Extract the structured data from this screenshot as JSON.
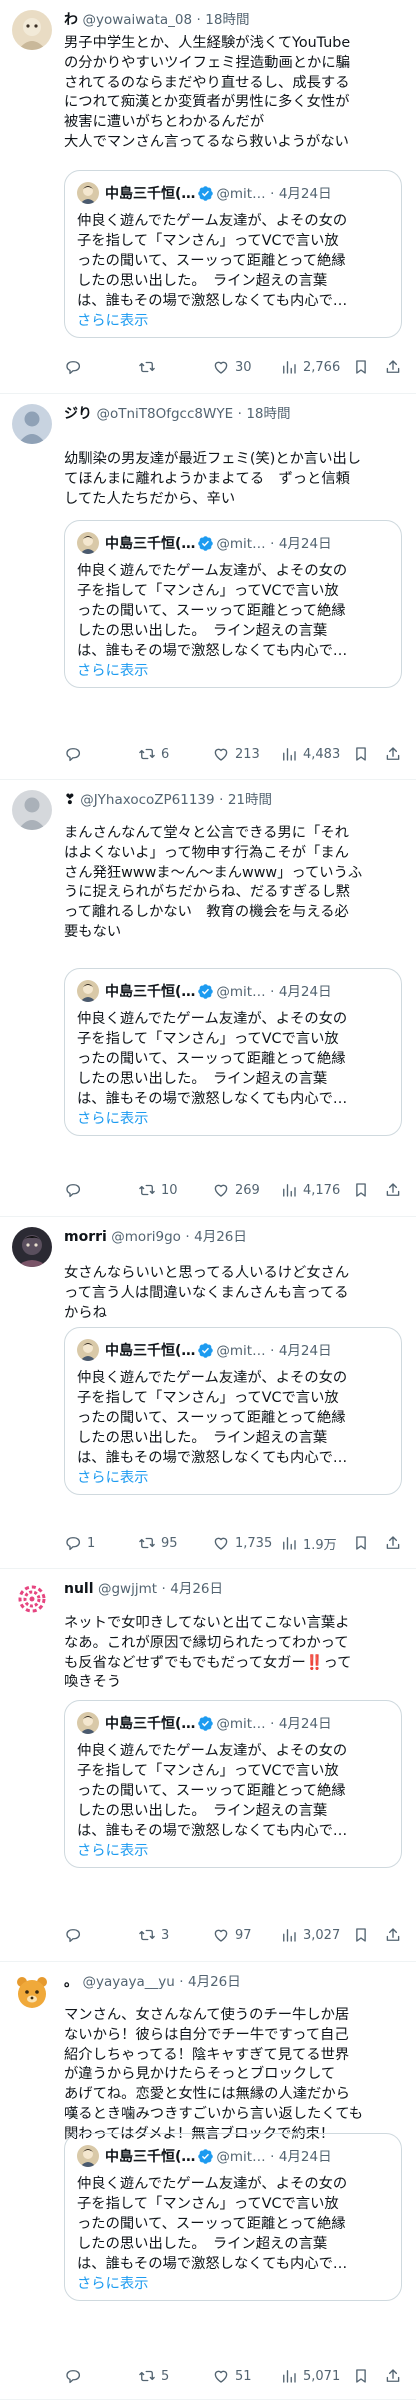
{
  "quoted": {
    "name": "中島三千恒(…",
    "handle": "@mit…",
    "dot": "·",
    "time": "4月24日",
    "lines": [
      "仲良く遊んでたゲーム友達が、よその女の",
      "子を指して「マンさん」ってVCで言い放",
      "ったの聞いて、スーッって距離とって絶縁",
      "したの思い出した。　ライン超えの言葉",
      "は、誰もその場で激怒しなくても内心で…"
    ],
    "more": "さらに表示"
  },
  "tweets": [
    {
      "name": "わ",
      "handle": "@yowaiwata_08",
      "dot": "·",
      "time": "18時間",
      "lines": [
        "男子中学生とか、人生経験が浅くてYouTube",
        "の分かりやすいツイフェミ捏造動画とかに騙",
        "されてるのならまだやり直せるし、成長する",
        "につれて痴漢とか変質者が男性に多く女性が",
        "被害に遭いがちとわかるんだが",
        "大人でマンさん言ってるなら救いようがない"
      ],
      "replies": "",
      "retweets": "",
      "likes": "30",
      "views": "2,766"
    },
    {
      "name": "ジり",
      "handle": "@oTniT8Ofgcc8WYE",
      "dot": "·",
      "time": "18時間",
      "lines": [
        "幼馴染の男友達が最近フェミ(笑)とか言い出し",
        "てほんまに離れようかまよてる　ずっと信頼",
        "してた人たちだから、辛い"
      ],
      "replies": "",
      "retweets": "6",
      "likes": "213",
      "views": "4,483"
    },
    {
      "name": "❣",
      "handle": "@JYhaxocoZP61139",
      "dot": "·",
      "time": "21時間",
      "lines": [
        "まんさんなんて堂々と公言できる男に「それ",
        "はよくないよ」って物申す行為こそが「まん",
        "さん発狂wwwま〜ん〜まんwww」っていうふ",
        "うに捉えられがちだからね、だるすぎるし黙",
        "って離れるしかない　教育の機会を与える必",
        "要もない"
      ],
      "replies": "",
      "retweets": "10",
      "likes": "269",
      "views": "4,176"
    },
    {
      "name": "morri",
      "handle": "@mori9go",
      "dot": "·",
      "time": "4月26日",
      "lines": [
        "女さんならいいと思ってる人いるけど女さん",
        "って言う人は間違いなくまんさんも言ってる",
        "からね"
      ],
      "replies": "1",
      "retweets": "95",
      "likes": "1,735",
      "views": "1.9万"
    },
    {
      "name": "null",
      "handle": "@gwjjmt",
      "dot": "·",
      "time": "4月26日",
      "lines": [
        "ネットで女叩きしてないと出てこない言葉よ",
        "なあ。これが原因で縁切られたってわかって",
        "も反省などせずでもでもだって女ガー‼️って",
        "喚きそう"
      ],
      "replies": "",
      "retweets": "3",
      "likes": "97",
      "views": "3,027"
    },
    {
      "name": "。",
      "handle": "@yayaya__yu",
      "dot": "·",
      "time": "4月26日",
      "lines": [
        "マンさん、女さんなんて使うのチー牛しか居",
        "ないから！彼らは自分でチー牛ですって自己",
        "紹介しちゃってる！陰キャすぎて見てる世界",
        "が違うから見かけたらそっとブロックして",
        "あげてね。恋愛と女性には無縁の人達だから",
        "嘆るとき噛みつきすごいから言い返したくても",
        "関わってはダメよ！無言ブロックで約束！"
      ],
      "replies": "",
      "retweets": "5",
      "likes": "51",
      "views": "5,071"
    }
  ]
}
